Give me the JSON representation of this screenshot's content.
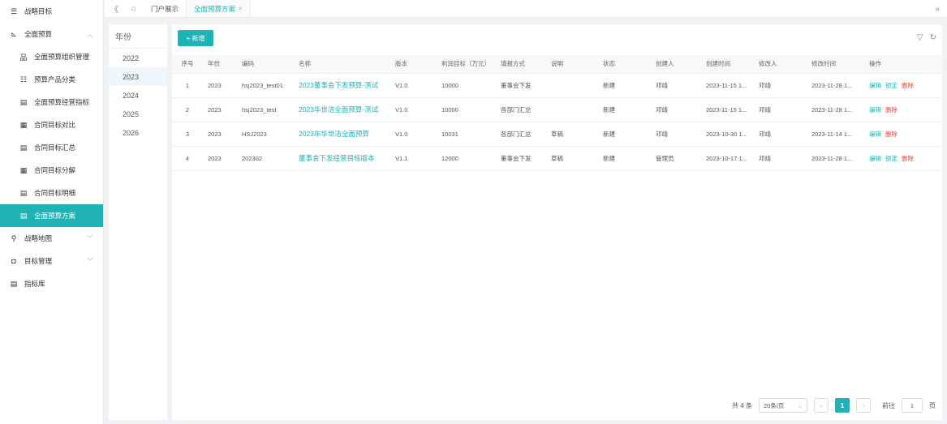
{
  "sidebar": {
    "items": [
      {
        "label": "战略目标",
        "icon": "strategy-icon",
        "glyph": "☰",
        "sub": false,
        "active": false,
        "caret": ""
      },
      {
        "label": "全面预算",
        "icon": "budget-folder-icon",
        "glyph": "⊾",
        "sub": false,
        "active": false,
        "caret": "︿"
      },
      {
        "label": "全面预算组织管理",
        "icon": "org-icon",
        "glyph": "品",
        "sub": true,
        "active": false,
        "caret": ""
      },
      {
        "label": "预算产品分类",
        "icon": "category-icon",
        "glyph": "☷",
        "sub": true,
        "active": false,
        "caret": ""
      },
      {
        "label": "全面预算经营指标",
        "icon": "indicator-icon",
        "glyph": "▤",
        "sub": true,
        "active": false,
        "caret": ""
      },
      {
        "label": "合同目标对比",
        "icon": "compare-icon",
        "glyph": "▦",
        "sub": true,
        "active": false,
        "caret": ""
      },
      {
        "label": "合同目标汇总",
        "icon": "summary-icon",
        "glyph": "▤",
        "sub": true,
        "active": false,
        "caret": ""
      },
      {
        "label": "合同目标分解",
        "icon": "decompose-icon",
        "glyph": "▦",
        "sub": true,
        "active": false,
        "caret": ""
      },
      {
        "label": "合同目标明细",
        "icon": "detail-icon",
        "glyph": "▤",
        "sub": true,
        "active": false,
        "caret": ""
      },
      {
        "label": "全面预算方案",
        "icon": "plan-icon",
        "glyph": "▤",
        "sub": true,
        "active": true,
        "caret": ""
      },
      {
        "label": "战略地图",
        "icon": "map-pin-icon",
        "glyph": "⚲",
        "sub": false,
        "active": false,
        "caret": "﹀"
      },
      {
        "label": "目标管理",
        "icon": "target-icon",
        "glyph": "◘",
        "sub": false,
        "active": false,
        "caret": "﹀"
      },
      {
        "label": "指标库",
        "icon": "library-icon",
        "glyph": "▤",
        "sub": false,
        "active": false,
        "caret": ""
      }
    ]
  },
  "tabs": {
    "collapse_glyph": "《",
    "home_glyph": "⌂",
    "items": [
      {
        "label": "门户展示",
        "active": false
      },
      {
        "label": "全面预算方案",
        "active": true
      }
    ],
    "close_glyph": "×",
    "more_glyph": "»"
  },
  "year_panel": {
    "title": "年份",
    "years": [
      {
        "label": "2022",
        "active": false
      },
      {
        "label": "2023",
        "active": true
      },
      {
        "label": "2024",
        "active": false
      },
      {
        "label": "2025",
        "active": false
      },
      {
        "label": "2026",
        "active": false
      }
    ]
  },
  "toolbar": {
    "new_label": "+ 新增",
    "filter_glyph": "▽",
    "refresh_glyph": "↻"
  },
  "table": {
    "columns": [
      "序号",
      "年份",
      "编码",
      "名称",
      "版本",
      "利润目标（万元）",
      "填报方式",
      "说明",
      "状态",
      "创建人",
      "创建时间",
      "修改人",
      "修改时间",
      "操作"
    ],
    "rows": [
      {
        "no": "1",
        "year": "2023",
        "code": "hsj2023_test01",
        "name": "2023董事会下发预算-测试",
        "version": "V1.0",
        "profit": "10000",
        "mode": "董事会下发",
        "note": "",
        "status": "新建",
        "creator": "邓靖",
        "created": "2023-11-15 1...",
        "modifier": "邓靖",
        "modified": "2023-11-28 1...",
        "actions": [
          "编辑",
          "锁定",
          "删除"
        ]
      },
      {
        "no": "2",
        "year": "2023",
        "code": "hsj2023_test",
        "name": "2023华世洁全面预算-测试",
        "version": "V1.0",
        "profit": "10000",
        "mode": "各部门汇总",
        "note": "",
        "status": "新建",
        "creator": "邓靖",
        "created": "2023-11-15 1...",
        "modifier": "邓靖",
        "modified": "2023-11-28 1...",
        "actions": [
          "编辑",
          "删除"
        ]
      },
      {
        "no": "3",
        "year": "2023",
        "code": "HSJ2023",
        "name": "2023年华世洁全面预算",
        "version": "V1.0",
        "profit": "10031",
        "mode": "各部门汇总",
        "note": "草稿",
        "status": "新建",
        "creator": "邓靖",
        "created": "2023-10-30 1...",
        "modifier": "邓靖",
        "modified": "2023-11-14 1...",
        "actions": [
          "编辑",
          "删除"
        ]
      },
      {
        "no": "4",
        "year": "2023",
        "code": "202302",
        "name": "董事会下发经营目标版本",
        "version": "V1.1",
        "profit": "12000",
        "mode": "董事会下发",
        "note": "草稿",
        "status": "新建",
        "creator": "管理员",
        "created": "2023-10-17 1...",
        "modifier": "邓靖",
        "modified": "2023-11-28 1...",
        "actions": [
          "编辑",
          "锁定",
          "删除"
        ]
      }
    ]
  },
  "pagination": {
    "total": "共 4 条",
    "page_size": "20条/页",
    "prev": "‹",
    "current": "1",
    "next": "›",
    "goto_label": "前往",
    "goto_value": "1",
    "page_suffix": "页"
  },
  "colors": {
    "accent": "#1fb3b6",
    "danger": "#f0403a"
  }
}
